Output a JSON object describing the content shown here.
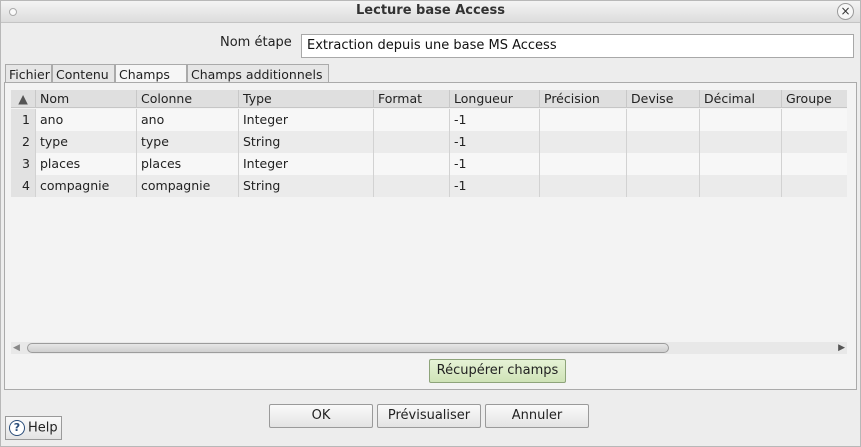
{
  "window": {
    "title": "Lecture base Access",
    "close_glyph": "×"
  },
  "step": {
    "label": "Nom étape",
    "value": "Extraction depuis une base MS Access"
  },
  "tabs": [
    {
      "label": "Fichier",
      "active": false
    },
    {
      "label": "Contenu",
      "active": false
    },
    {
      "label": "Champs",
      "active": true
    },
    {
      "label": "Champs additionnels",
      "active": false
    }
  ],
  "table": {
    "sort_glyph": "▲",
    "columns": [
      "Nom",
      "Colonne",
      "Type",
      "Format",
      "Longueur",
      "Précision",
      "Devise",
      "Décimal",
      "Groupe"
    ],
    "rows": [
      {
        "num": "1",
        "cells": [
          "ano",
          "ano",
          "Integer",
          "",
          "-1",
          "",
          "",
          "",
          ""
        ]
      },
      {
        "num": "2",
        "cells": [
          "type",
          "type",
          "String",
          "",
          "-1",
          "",
          "",
          "",
          ""
        ]
      },
      {
        "num": "3",
        "cells": [
          "places",
          "places",
          "Integer",
          "",
          "-1",
          "",
          "",
          "",
          ""
        ]
      },
      {
        "num": "4",
        "cells": [
          "compagnie",
          "compagnie",
          "String",
          "",
          "-1",
          "",
          "",
          "",
          ""
        ]
      }
    ]
  },
  "buttons": {
    "get_fields": "Récupérer champs",
    "ok": "OK",
    "preview": "Prévisualiser",
    "cancel": "Annuler",
    "help": "Help",
    "help_glyph": "?"
  },
  "scroll": {
    "left_glyph": "◀",
    "right_glyph": "▶"
  }
}
